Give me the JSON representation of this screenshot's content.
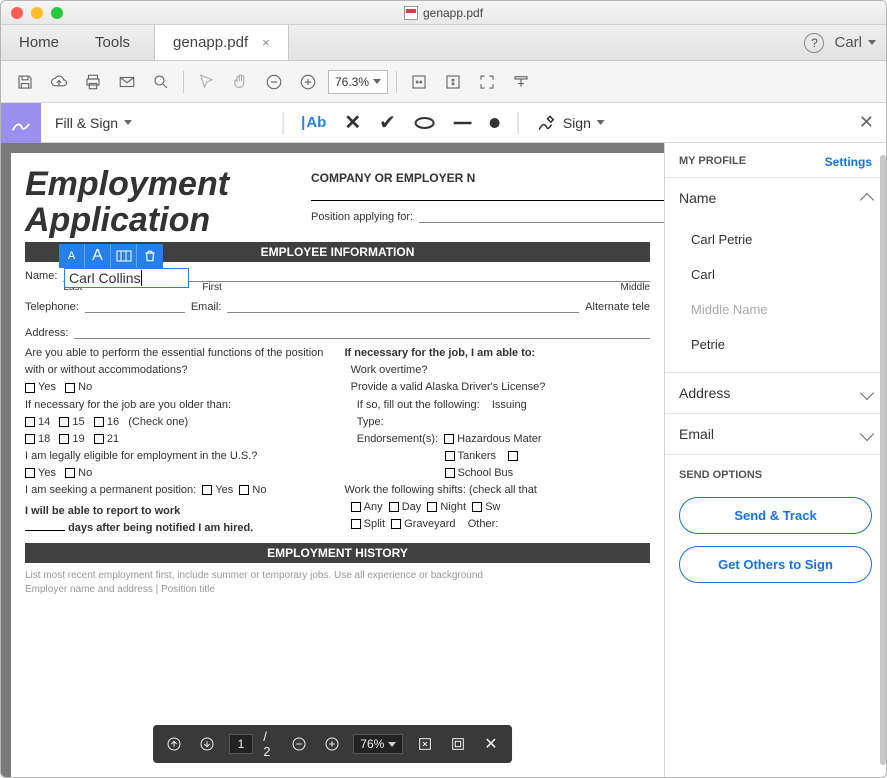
{
  "window": {
    "title": "genapp.pdf"
  },
  "tabs": {
    "home": "Home",
    "tools": "Tools",
    "doc": "genapp.pdf",
    "user": "Carl"
  },
  "toolbar": {
    "zoom": "76.3%"
  },
  "fillsign": {
    "label": "Fill & Sign",
    "addtext": "Ab",
    "sign": "Sign"
  },
  "form": {
    "title1": "Employment",
    "title2": "Application",
    "company": "COMPANY OR EMPLOYER N",
    "position": "Position applying for:",
    "sec_empinfo": "EMPLOYEE INFORMATION",
    "name": "Name:",
    "last": "Last",
    "first": "First",
    "middle": "Middle",
    "tel": "Telephone:",
    "email": "Email:",
    "alt": "Alternate tele",
    "address": "Address:",
    "q_essential": "Are you able to perform the essential functions of the position with or without accommodations?",
    "yes": "Yes",
    "no": "No",
    "q_older": "If necessary for the job are you older than:",
    "a14": "14",
    "a15": "15",
    "a16": "16",
    "checkone": "(Check one)",
    "a18": "18",
    "a19": "19",
    "a21": "21",
    "q_eligible": "I am legally eligible for employment in the U.S.?",
    "q_perm": "I am seeking a permanent position:",
    "q_report1": "I will be able to report to work",
    "q_report2": "days after being notified I am hired.",
    "r_necessary": "If necessary for the job, I am able to:",
    "r_overtime": "Work overtime?",
    "r_license": "Provide a valid Alaska Driver's License?",
    "r_fillout": "If so, fill out the following:",
    "r_issuing": "Issuing",
    "r_type": "Type:",
    "r_endorse": "Endorsement(s):",
    "r_hazmat": "Hazardous Mater",
    "r_tankers": "Tankers",
    "r_schoolbus": "School Bus",
    "r_shifts": "Work the following shifts: (check all that",
    "r_any": "Any",
    "r_day": "Day",
    "r_night": "Night",
    "r_sw": "Sw",
    "r_split": "Split",
    "r_grave": "Graveyard",
    "r_other": "Other:",
    "sec_history": "EMPLOYMENT HISTORY",
    "input_value": "Carl Collins"
  },
  "bottombar": {
    "page": "1",
    "total": "2",
    "zoom": "76%"
  },
  "sidebar": {
    "profile": "MY PROFILE",
    "settings": "Settings",
    "name": "Name",
    "addr": "Address",
    "email": "Email",
    "items": [
      "Carl Petrie",
      "Carl",
      "Middle Name",
      "Petrie"
    ],
    "send": "SEND OPTIONS",
    "btn1": "Send & Track",
    "btn2": "Get Others to Sign"
  }
}
